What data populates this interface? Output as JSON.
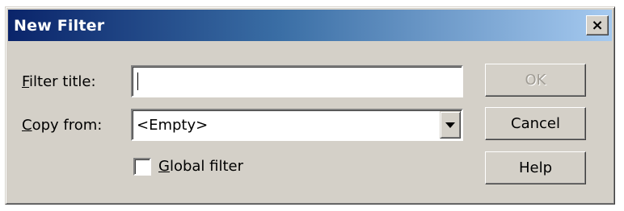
{
  "window": {
    "title": "New Filter",
    "close_label": "×"
  },
  "form": {
    "filter_title_label": "Filter title:",
    "filter_title_accel": "F",
    "filter_title_rest": "ilter title:",
    "filter_title_value": "",
    "copy_from_label": "Copy from:",
    "copy_from_accel": "C",
    "copy_from_rest": "opy from:",
    "copy_from_value": "<Empty>",
    "global_filter_label": "Global filter",
    "global_filter_accel": "G",
    "global_filter_rest": "lobal filter",
    "global_filter_checked": false
  },
  "buttons": {
    "ok_label": "OK",
    "ok_enabled": false,
    "cancel_label": "Cancel",
    "help_label": "Help"
  },
  "colors": {
    "dialog_face": "#d4d0c8",
    "title_start": "#0a246a",
    "title_end": "#a6caf0",
    "title_text": "#ffffff",
    "disabled_text": "#a09c94"
  },
  "icons": {
    "close": "close-icon",
    "dropdown": "chevron-down-icon"
  }
}
